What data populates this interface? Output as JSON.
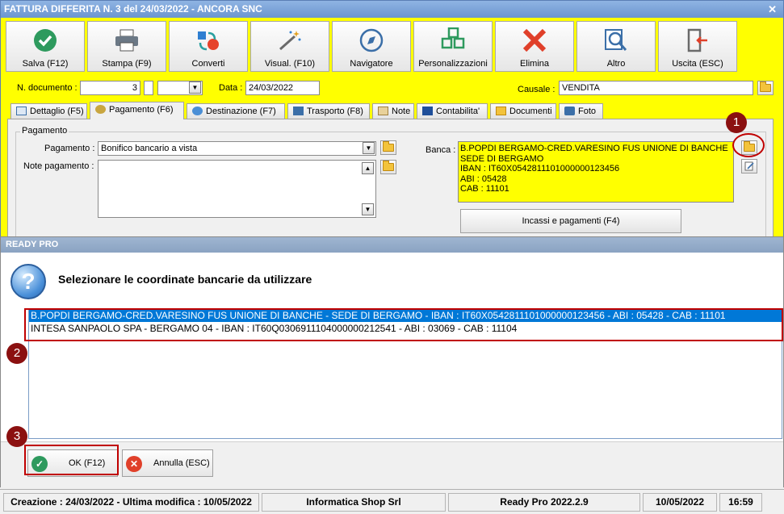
{
  "window": {
    "title": "FATTURA DIFFERITA N. 3 del 24/03/2022 - ANCORA SNC",
    "close_glyph": "✕"
  },
  "toolbar": [
    {
      "label": "Salva (F12)",
      "icon": "save-check-icon"
    },
    {
      "label": "Stampa (F9)",
      "icon": "printer-icon"
    },
    {
      "label": "Converti",
      "icon": "convert-icon"
    },
    {
      "label": "Visual. (F10)",
      "icon": "magic-wand-icon"
    },
    {
      "label": "Navigatore",
      "icon": "compass-icon"
    },
    {
      "label": "Personalizzazioni",
      "icon": "grid-icon"
    },
    {
      "label": "Elimina",
      "icon": "delete-x-icon"
    },
    {
      "label": "Altro",
      "icon": "magnifier-icon"
    },
    {
      "label": "Uscita (ESC)",
      "icon": "exit-door-icon"
    }
  ],
  "header": {
    "doc_number_label": "N. documento :",
    "doc_number": "3",
    "date_label": "Data :",
    "date": "24/03/2022",
    "causale_label": "Causale :",
    "causale": "VENDITA"
  },
  "tabs": [
    {
      "label": "Dettaglio (F5)",
      "icon": "table-icon"
    },
    {
      "label": "Pagamento (F6)",
      "icon": "coins-icon"
    },
    {
      "label": "Destinazione (F7)",
      "icon": "globe-icon"
    },
    {
      "label": "Trasporto (F8)",
      "icon": "truck-icon"
    },
    {
      "label": "Note",
      "icon": "note-icon"
    },
    {
      "label": "Contabilita'",
      "icon": "book-icon"
    },
    {
      "label": "Documenti",
      "icon": "documents-icon"
    },
    {
      "label": "Foto",
      "icon": "camera-icon"
    }
  ],
  "payment": {
    "group_title": "Pagamento",
    "payment_label": "Pagamento :",
    "payment_value": "Bonifico bancario a vista",
    "notes_label": "Note pagamento :",
    "notes_value": "",
    "bank_label": "Banca :",
    "bank_lines": [
      "B.POPDI BERGAMO-CRED.VARESINO FUS UNIONE DI BANCHE",
      "SEDE DI BERGAMO",
      "IBAN : IT60X0542811101000000123456",
      "ABI : 05428",
      "CAB : 11101"
    ],
    "incassi_button": "Incassi e pagamenti (F4)"
  },
  "dialog": {
    "title": "READY PRO",
    "question_glyph": "?",
    "message": "Selezionare le coordinate bancarie da utilizzare",
    "options": [
      "B.POPDI BERGAMO-CRED.VARESINO FUS UNIONE DI BANCHE - SEDE DI BERGAMO - IBAN : IT60X0542811101000000123456 - ABI : 05428 - CAB : 11101",
      "INTESA SANPAOLO SPA - BERGAMO 04 - IBAN : IT60Q0306911104000000212541 - ABI : 03069 - CAB : 11104"
    ],
    "ok_button": "OK (F12)",
    "cancel_button": "Annulla (ESC)"
  },
  "annotations": [
    "1",
    "2",
    "3"
  ],
  "status": {
    "created": "Creazione : 24/03/2022 - Ultima modifica : 10/05/2022",
    "company": "Informatica Shop Srl",
    "version": "Ready Pro 2022.2.9",
    "date": "10/05/2022",
    "time": "16:59"
  },
  "colors": {
    "form_background": "#ffff00",
    "selection": "#0078d7",
    "annotation": "#8b1010",
    "highlight_box": "#c00000"
  }
}
